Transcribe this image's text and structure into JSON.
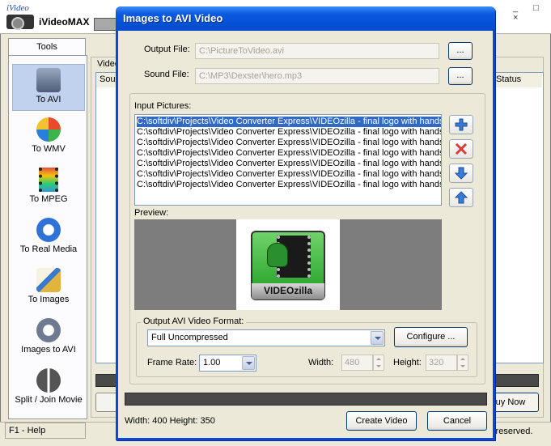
{
  "main_window": {
    "logo_text": "iVideo",
    "app_name": "iVideoMAX",
    "window_controls": "_ □ ×",
    "tools_tab": "Tools",
    "tools": [
      {
        "label": "To AVI",
        "icon": "camcorder-icon",
        "active": true
      },
      {
        "label": "To WMV",
        "icon": "windows-media-icon",
        "active": false
      },
      {
        "label": "To MPEG",
        "icon": "filmstrip-icon",
        "active": false
      },
      {
        "label": "To Real Media",
        "icon": "real-media-icon",
        "active": false
      },
      {
        "label": "To Images",
        "icon": "paintbrush-icon",
        "active": false
      },
      {
        "label": "Images to AVI",
        "icon": "images-to-video-icon",
        "active": false
      },
      {
        "label": "Split / Join Movie",
        "icon": "split-film-icon",
        "active": false
      }
    ],
    "video_group_label": "Video",
    "list_columns": {
      "source": "Sou",
      "status": "Status"
    },
    "buy_now": "uy Now",
    "status_help": "F1 - Help",
    "status_right": "s reserved."
  },
  "dialog": {
    "title": "Images to AVI Video",
    "output_file": {
      "label": "Output File:",
      "value": "C:\\PictureToVideo.avi",
      "browse": "..."
    },
    "sound_file": {
      "label": "Sound File:",
      "value": "C:\\MP3\\Dexster\\hero.mp3",
      "browse": "..."
    },
    "input_pictures_label": "Input Pictures:",
    "input_pictures": [
      "C:\\softdiv\\Projects\\Video Converter Express\\VIDEOzilla - final logo with hands\\",
      "C:\\softdiv\\Projects\\Video Converter Express\\VIDEOzilla - final logo with hands\\",
      "C:\\softdiv\\Projects\\Video Converter Express\\VIDEOzilla - final logo with hands\\",
      "C:\\softdiv\\Projects\\Video Converter Express\\VIDEOzilla - final logo with hands\\",
      "C:\\softdiv\\Projects\\Video Converter Express\\VIDEOzilla - final logo with hands\\",
      "C:\\softdiv\\Projects\\Video Converter Express\\VIDEOzilla - final logo with hands\\",
      "C:\\softdiv\\Projects\\Video Converter Express\\VIDEOzilla - final logo with hands\\"
    ],
    "selected_picture_index": 0,
    "side_buttons": [
      "add-icon",
      "remove-icon",
      "move-down-icon",
      "move-up-icon"
    ],
    "preview_label": "Preview:",
    "preview_logo_text": "VIDEOzilla",
    "output_format": {
      "label": "Output AVI Video Format:",
      "selected": "Full Uncompressed",
      "configure": "Configure ..."
    },
    "frame_rate": {
      "label": "Frame Rate:",
      "value": "1.00"
    },
    "width": {
      "label": "Width:",
      "value": "480"
    },
    "height": {
      "label": "Height:",
      "value": "320"
    },
    "dimensions_text": "Width:  400 Height: 350",
    "create_video": "Create Video",
    "cancel": "Cancel"
  },
  "colors": {
    "title_bar": "#0351d6",
    "selection": "#316ac5",
    "window_bg": "#ece9d8",
    "add_icon": "#3a7bd5",
    "remove_icon": "#d63a3a"
  }
}
